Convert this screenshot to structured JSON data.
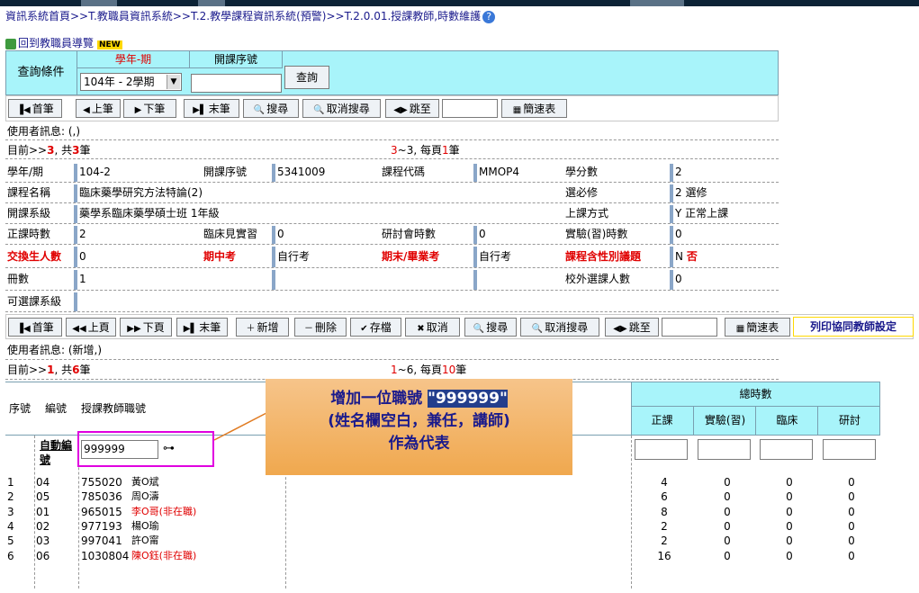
{
  "breadcrumb": "資訊系統首頁>>T.教職員資訊系統>>T.2.教學課程資訊系統(預警)>>T.2.0.01.授課教師,時數維護",
  "back_link": "回到教職員導覽",
  "new_badge": "NEW",
  "query": {
    "title": "查詢條件",
    "col_term": "學年-期",
    "col_course_no": "開課序號",
    "term_value": "104年 - 2學期",
    "course_no_value": "",
    "search_button": "查詢"
  },
  "toolbar1": {
    "first": "首筆",
    "prev": "上筆",
    "next": "下筆",
    "last": "末筆",
    "search": "搜尋",
    "cancel_search": "取消搜尋",
    "jump": "跳至",
    "jump_value": "",
    "quick_view": "簡速表"
  },
  "info1": {
    "user_msg": "使用者訊息: (,)",
    "current_prefix": "目前>>",
    "current_num": "3",
    "current_mid": ", 共",
    "current_total": "3",
    "current_suffix": "筆",
    "range_a": "3",
    "range_mid": "~3, 每頁",
    "range_per": "1",
    "range_suffix": "筆"
  },
  "course": {
    "term_label": "學年/期",
    "term": "104-2",
    "no_label": "開課序號",
    "no": "5341009",
    "code_label": "課程代碼",
    "code": "MMOP4",
    "credit_label": "學分數",
    "credit": "2",
    "name_label": "課程名稱",
    "name": "臨床藥學研究方法特論(2)",
    "req_label": "選必修",
    "req": "2 選修",
    "dept_label": "開課系級",
    "dept": "藥學系臨床藥學碩士班  1年級",
    "mode_label": "上課方式",
    "mode": "Y 正常上課",
    "hours_label": "正課時數",
    "hours": "2",
    "clinic_label": "臨床見實習",
    "clinic": "0",
    "seminar_label": "研討會時數",
    "seminar": "0",
    "lab_label": "實驗(習)時數",
    "lab": "0",
    "exchange_label": "交換生人數",
    "exchange": "0",
    "mid_label": "期中考",
    "mid": "自行考",
    "final_label": "期末/畢業考",
    "final": "自行考",
    "gender_label": "課程含性別議題",
    "gender_n": "N",
    "gender_txt": "否",
    "books_label": "冊數",
    "books": "1",
    "outside_label": "校外選課人數",
    "outside": "0",
    "elective_label": "可選課系級"
  },
  "toolbar2": {
    "first": "首筆",
    "prev_page": "上頁",
    "next_page": "下頁",
    "last": "末筆",
    "add": "新增",
    "delete": "刪除",
    "save": "存檔",
    "cancel": "取消",
    "search": "搜尋",
    "cancel_search": "取消搜尋",
    "jump": "跳至",
    "quick_view": "簡速表",
    "print": "列印協同教師設定"
  },
  "info2": {
    "user_msg": "使用者訊息: (新增,)",
    "current_prefix": "目前>>",
    "current_num": "1",
    "current_mid": ", 共",
    "current_total": "6",
    "current_suffix": "筆",
    "range_a": "1",
    "range_mid": "~6, 每頁",
    "range_per": "10",
    "range_suffix": "筆"
  },
  "grid": {
    "col_seq": "序號",
    "col_no": "編號",
    "col_teacher": "授課教師職號",
    "col_total": "總時數",
    "col_lecture": "正課",
    "col_lab": "實驗(習)",
    "col_clinic": "臨床",
    "col_seminar": "研討",
    "new_auto": "自動編號",
    "new_teacher_value": "999999",
    "rows": [
      {
        "seq": "1",
        "no": "04",
        "tid": "755020",
        "name": "黃O斌",
        "extra": "",
        "lec": "4",
        "lab": "0",
        "cli": "0",
        "sem": "0"
      },
      {
        "seq": "2",
        "no": "05",
        "tid": "785036",
        "name": "周O濤",
        "extra": "",
        "lec": "6",
        "lab": "0",
        "cli": "0",
        "sem": "0"
      },
      {
        "seq": "3",
        "no": "01",
        "tid": "965015",
        "name": "李O哥(非在職)",
        "extra": "red",
        "lec": "8",
        "lab": "0",
        "cli": "0",
        "sem": "0"
      },
      {
        "seq": "4",
        "no": "02",
        "tid": "977193",
        "name": "楊O瑜",
        "extra": "",
        "lec": "2",
        "lab": "0",
        "cli": "0",
        "sem": "0"
      },
      {
        "seq": "5",
        "no": "03",
        "tid": "997041",
        "name": "許O甯",
        "extra": "",
        "lec": "2",
        "lab": "0",
        "cli": "0",
        "sem": "0"
      },
      {
        "seq": "6",
        "no": "06",
        "tid": "1030804",
        "name": "陳O鈺(非在職)",
        "extra": "red",
        "lec": "16",
        "lab": "0",
        "cli": "0",
        "sem": "0"
      }
    ]
  },
  "callout": {
    "line1a": "增加一位職號",
    "line1b": "\"999999\"",
    "line2": "(姓名欄空白，兼任，講師)",
    "line3": "作為代表"
  },
  "colors": {
    "header_cyan": "#a8f4fa",
    "red_text": "#e00000",
    "highlight_box": "#e000e0",
    "callout_orange": "#f0a84e"
  }
}
